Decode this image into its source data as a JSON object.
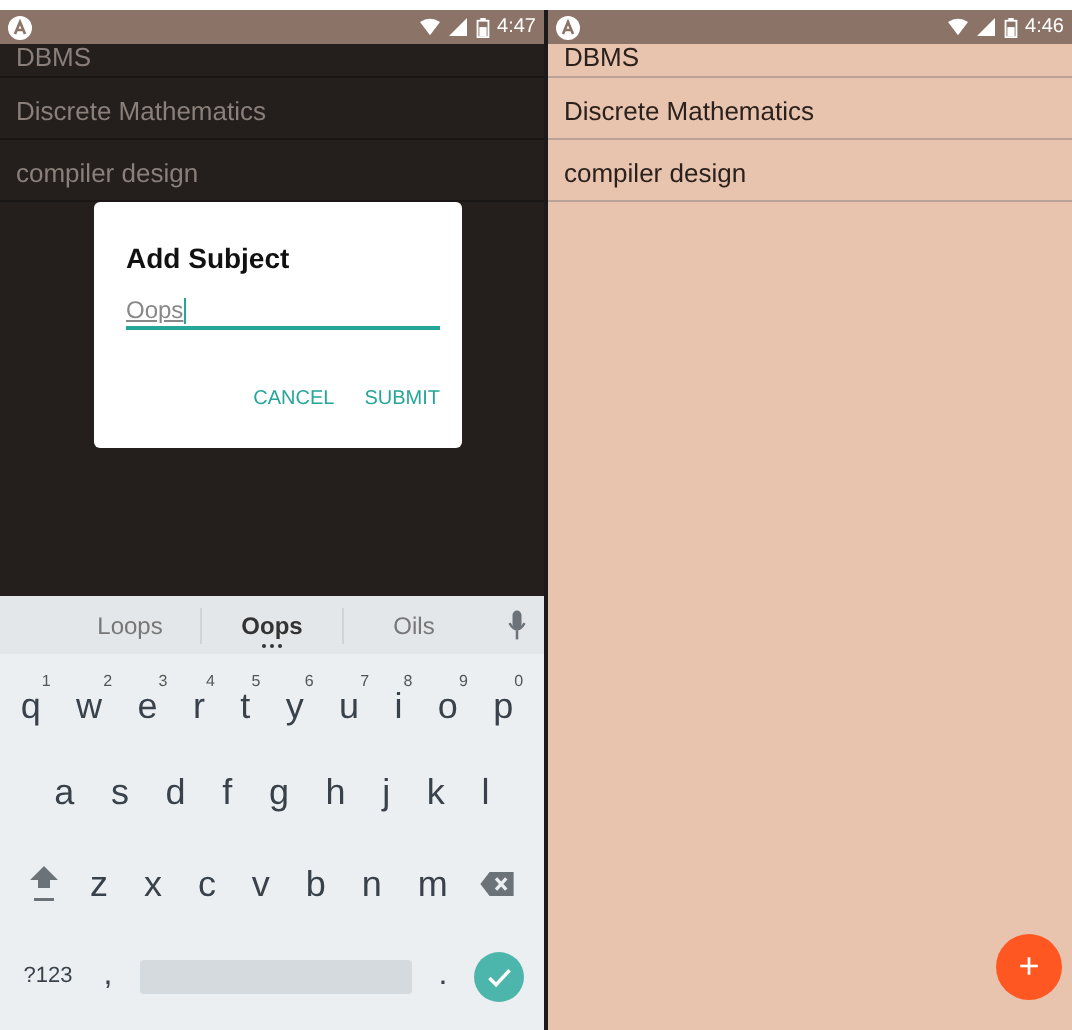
{
  "left_screen": {
    "status_bar": {
      "time": "4:47"
    },
    "list": [
      "DBMS",
      "Discrete Mathematics",
      "compiler design"
    ],
    "dialog": {
      "title": "Add Subject",
      "input": {
        "value": "Oops"
      },
      "buttons": [
        "CANCEL",
        "SUBMIT"
      ]
    },
    "keyboard": {
      "suggestions": [
        {
          "text": "Loops",
          "selected": false
        },
        {
          "text": "Oops",
          "selected": true
        },
        {
          "text": "Oils",
          "selected": false
        }
      ],
      "rows": [
        [
          {
            "label": "q",
            "hint": "1"
          },
          {
            "label": "w",
            "hint": "2"
          },
          {
            "label": "e",
            "hint": "3"
          },
          {
            "label": "r",
            "hint": "4"
          },
          {
            "label": "t",
            "hint": "5"
          },
          {
            "label": "y",
            "hint": "6"
          },
          {
            "label": "u",
            "hint": "7"
          },
          {
            "label": "i",
            "hint": "8"
          },
          {
            "label": "o",
            "hint": "9"
          },
          {
            "label": "p",
            "hint": "0"
          }
        ],
        [
          {
            "label": "a"
          },
          {
            "label": "s"
          },
          {
            "label": "d"
          },
          {
            "label": "f"
          },
          {
            "label": "g"
          },
          {
            "label": "h"
          },
          {
            "label": "j"
          },
          {
            "label": "k"
          },
          {
            "label": "l"
          }
        ],
        [
          {
            "label": "z"
          },
          {
            "label": "x"
          },
          {
            "label": "c"
          },
          {
            "label": "v"
          },
          {
            "label": "b"
          },
          {
            "label": "n"
          },
          {
            "label": "m"
          }
        ]
      ],
      "symbols_key": "?123",
      "comma_key": ",",
      "period_key": "."
    }
  },
  "right_screen": {
    "status_bar": {
      "time": "4:46"
    },
    "list": [
      "DBMS",
      "Discrete Mathematics",
      "compiler design"
    ],
    "fab": "+"
  }
}
